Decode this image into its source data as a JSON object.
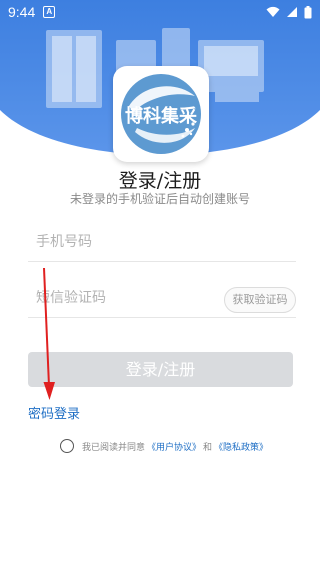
{
  "colors": {
    "banner_blue": "#3d7fe0",
    "banner_blue_light": "#6aa3ee",
    "link_blue": "#1f6fc5",
    "button_disabled": "#d9dbde",
    "annotation_red": "#e02020"
  },
  "status_bar": {
    "time": "9:44",
    "notification_icon": "a-letter-notification-icon",
    "right_icons": [
      "wifi-icon",
      "signal-icon",
      "battery-icon"
    ]
  },
  "logo": {
    "text": "博科集采",
    "icon": "app-logo-leaf-icon"
  },
  "header": {
    "title": "登录/注册",
    "subtitle": "未登录的手机验证后自动创建账号"
  },
  "form": {
    "phone_placeholder": "手机号码",
    "code_placeholder": "短信验证码",
    "get_code_label": "获取验证码",
    "submit_label": "登录/注册"
  },
  "links": {
    "password_login": "密码登录"
  },
  "agreement": {
    "prefix": "我已阅读并同意",
    "user_agreement": "《用户协议》",
    "and": "和",
    "privacy_policy": "《隐私政策》"
  }
}
